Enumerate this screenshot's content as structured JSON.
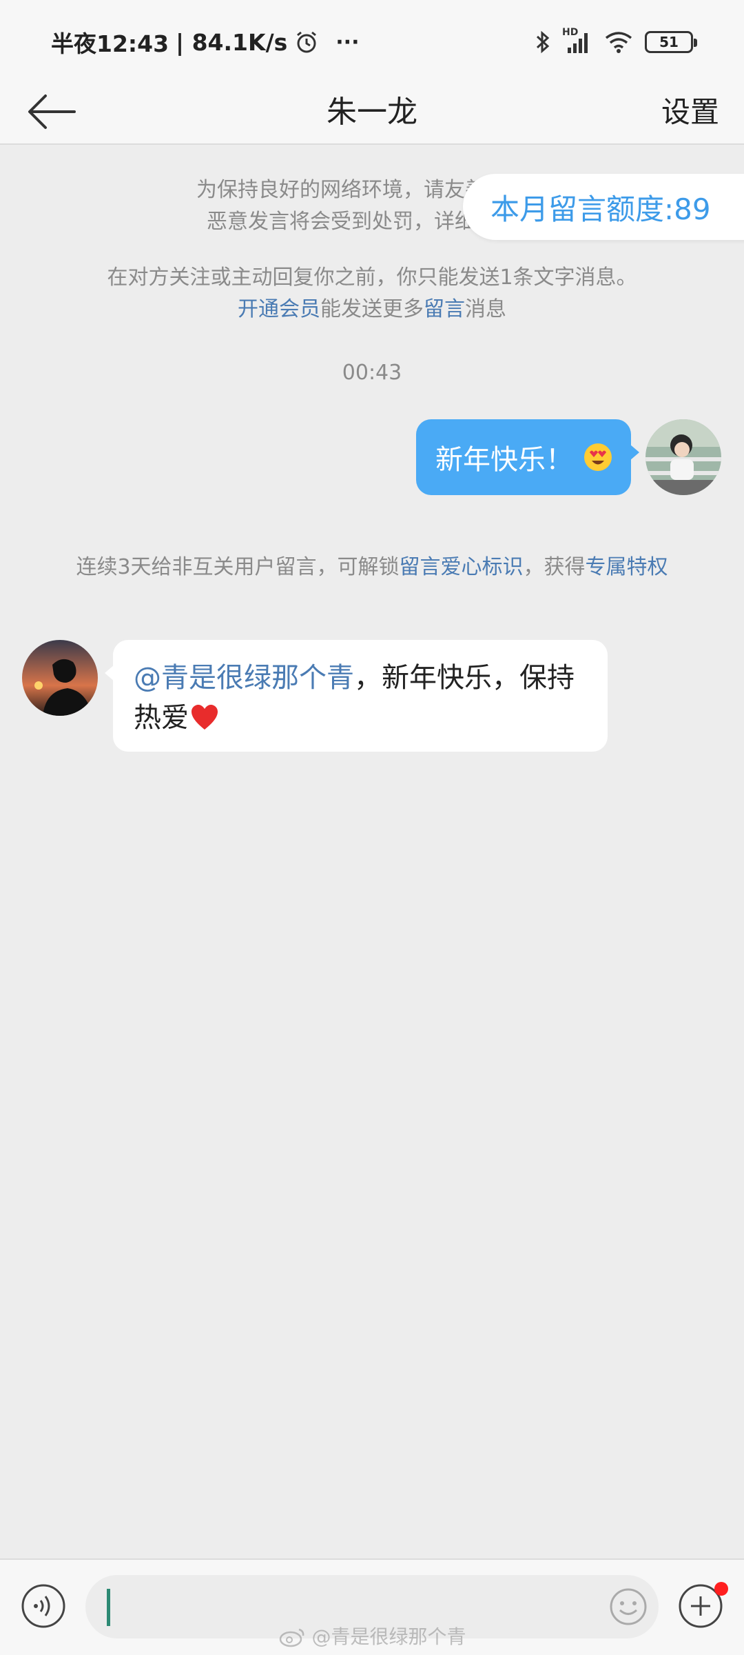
{
  "status_bar": {
    "time": "半夜12:43",
    "speed": "| 84.1K/s",
    "more": "···",
    "battery": "51",
    "network_label": "HD"
  },
  "nav": {
    "title": "朱一龙",
    "settings_label": "设置"
  },
  "notices": {
    "line1": "为保持良好的网络环境，请友善交流，",
    "line2": "恶意发言将会受到处罚，详细细则…",
    "limit_line1": "在对方关注或主动回复你之前，你只能发送1条文字消息。",
    "limit_line2_link1": "开通会员",
    "limit_line2_mid": "能发送更多",
    "limit_line2_link2": "留言",
    "limit_line2_end": "消息",
    "quota": "本月留言额度:89",
    "streak_prefix": "连续3天给非互关用户留言，可解锁",
    "streak_link1": "留言爱心标识",
    "streak_mid": "，获得",
    "streak_link2": "专属特权"
  },
  "timestamp": "00:43",
  "messages": {
    "outgoing": {
      "text": "新年快乐！",
      "emoji": "heart-eyes-emoji"
    },
    "incoming": {
      "mention": "@青是很绿那个青",
      "text": "，新年快乐，保持热爱",
      "emoji": "red-heart-emoji"
    }
  },
  "input_bar": {
    "placeholder": ""
  },
  "watermark": "@青是很绿那个青",
  "colors": {
    "accent_blue": "#4aaaf5",
    "link_blue": "#4a7bb3",
    "quota_blue": "#3d9be9",
    "background": "#ededed",
    "cursor_green": "#2d8a74",
    "badge_red": "#ff1f1f"
  }
}
